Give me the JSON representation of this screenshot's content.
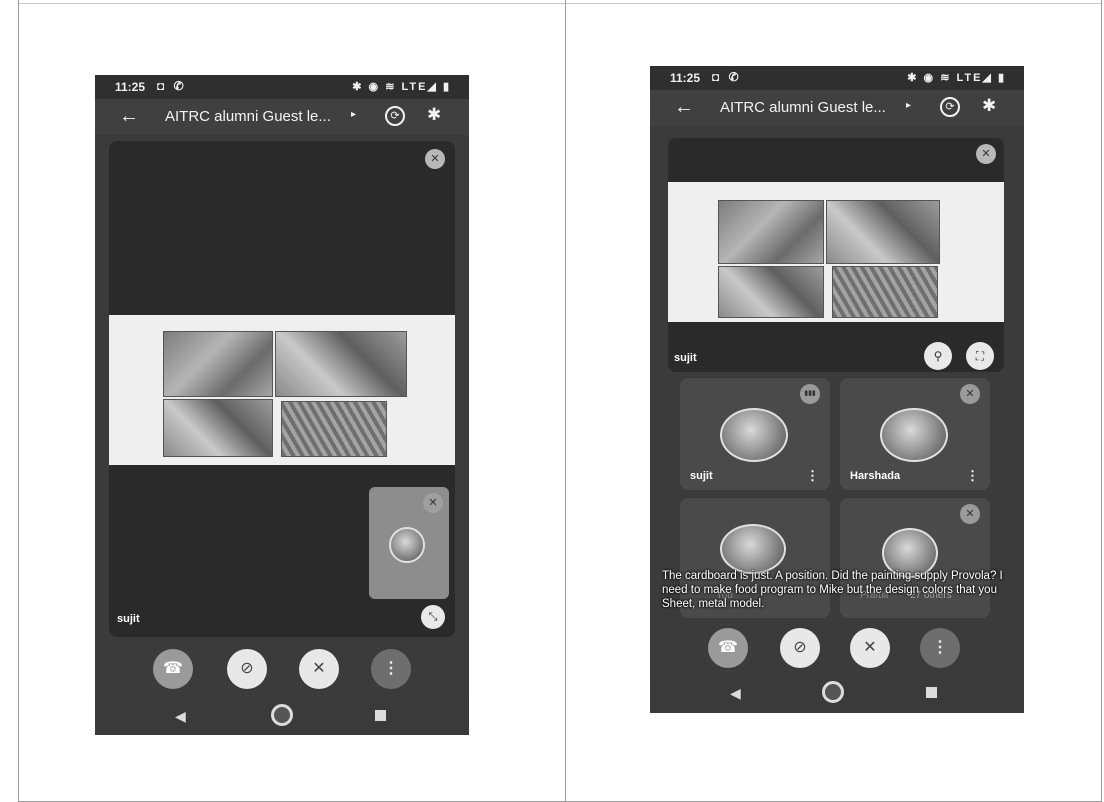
{
  "left_screen": {
    "status": {
      "time": "11:25",
      "notif_icons": "◘ ✆",
      "indicators": "✱ ◉ ≋ LTE◢ ▮"
    },
    "app_bar": {
      "title": "AITRC alumni Guest le...",
      "chevron": "▸",
      "back_icon": "←",
      "camera_switch_icon": "⟳",
      "bluetooth_icon": "✱"
    },
    "main_tile": {
      "participant_name": "sujit",
      "muted_icon": "✕",
      "collapse_icon": "⤡"
    },
    "self_view": {
      "muted_icon": "✕"
    },
    "controls": {
      "end_call_icon": "☎",
      "camera_off_icon": "⊘",
      "mic_off_icon": "✕",
      "more_icon": "⋮"
    },
    "nav": {
      "back": "◀",
      "recents": "■"
    }
  },
  "right_screen": {
    "status": {
      "time": "11:25",
      "notif_icons": "◘ ✆",
      "indicators": "✱ ◉ ≋ LTE◢ ▮"
    },
    "app_bar": {
      "title": "AITRC alumni Guest le...",
      "chevron": "▸",
      "back_icon": "←",
      "camera_switch_icon": "⟳",
      "bluetooth_icon": "✱"
    },
    "presentation_tile": {
      "participant_name": "sujit",
      "muted_icon": "✕",
      "pin_icon": "⚲",
      "fullscreen_icon": "⛶"
    },
    "participants": [
      {
        "name": "sujit",
        "badge_icon": "▮▮▮",
        "more_icon": "⋮"
      },
      {
        "name": "Harshada",
        "badge_icon": "✕",
        "more_icon": "⋮"
      }
    ],
    "bottom_labels": {
      "you": "You",
      "partial": "Prafull",
      "others": "27 others"
    },
    "caption": "The cardboard is just. A position. Did the painting supply Provola? I need to make food program to Mike but the design colors that you Sheet, metal model.",
    "controls": {
      "end_call_icon": "☎",
      "camera_off_icon": "⊘",
      "mic_off_icon": "✕",
      "more_icon": "⋮"
    },
    "nav": {
      "back": "◀",
      "recents": "■"
    }
  }
}
